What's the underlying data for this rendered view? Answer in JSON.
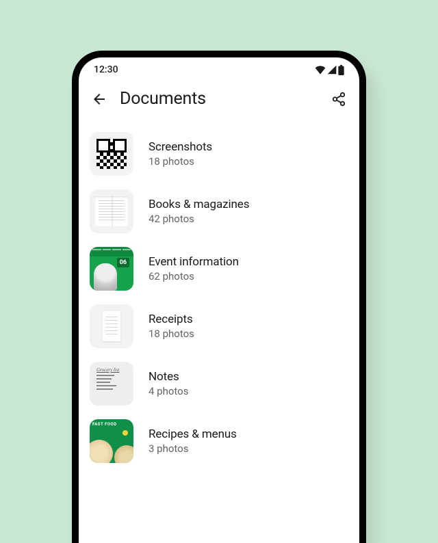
{
  "status": {
    "time": "12:30"
  },
  "header": {
    "title": "Documents"
  },
  "categories": [
    {
      "name": "Screenshots",
      "count": "18 photos"
    },
    {
      "name": "Books & magazines",
      "count": "42 photos"
    },
    {
      "name": "Event information",
      "count": "62 photos"
    },
    {
      "name": "Receipts",
      "count": "18 photos"
    },
    {
      "name": "Notes",
      "count": "4 photos"
    },
    {
      "name": "Recipes & menus",
      "count": "3 photos"
    }
  ],
  "thumbnails": {
    "event_badge": "06",
    "notes_header": "Grocery list",
    "recipe_label": "FAST FOOD"
  }
}
